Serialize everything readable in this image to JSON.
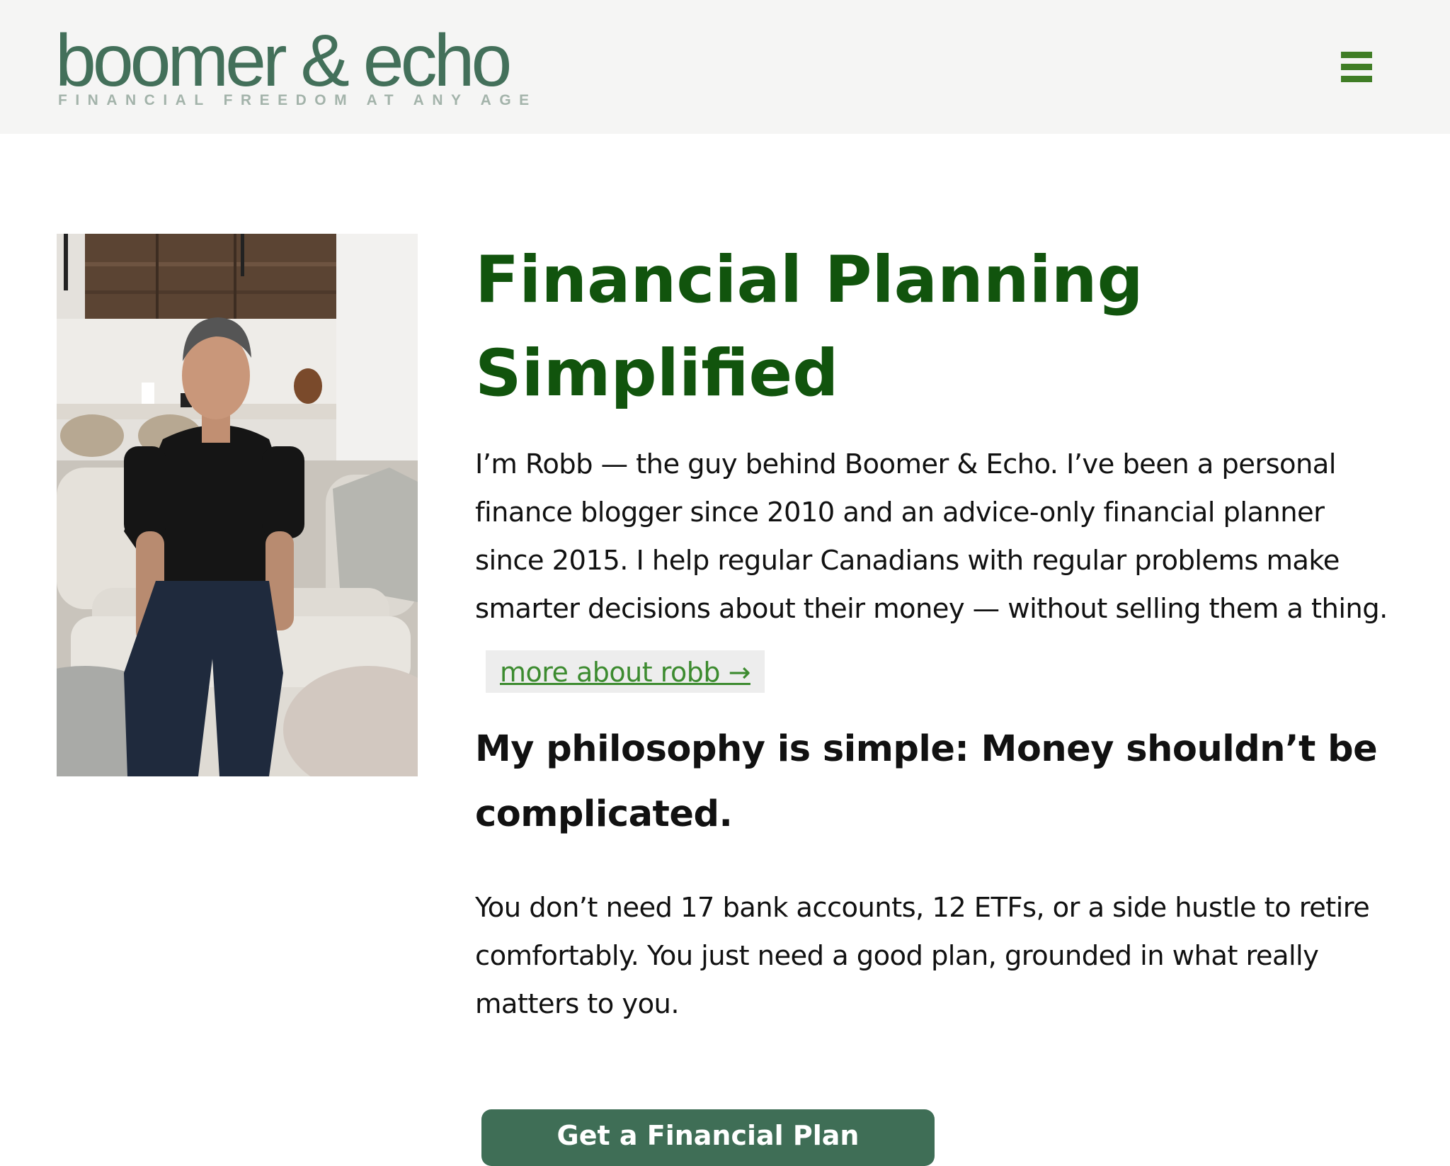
{
  "header": {
    "logo_name": "boomer & echo",
    "logo_tagline": "FINANCIAL FREEDOM AT ANY AGE",
    "menu_icon": "hamburger-menu-icon"
  },
  "hero": {
    "photo_icon": "portrait-photo",
    "title": "Financial Planning Simplified",
    "intro": "I’m Robb — the guy behind Boomer & Echo. I’ve been a personal finance blogger since 2010 and an advice-only financial planner since 2015. I help regular Canadians with regular problems make smarter decisions about their money — without selling them a thing.",
    "more_link": "more about robb →",
    "philosophy_heading": "My philosophy is simple: Money shouldn’t be complicated.",
    "body": "You don’t need 17 bank accounts, 12 ETFs, or a side hustle to retire comfortably. You just need a good plan, grounded in what really matters to you.",
    "cta_label": "Get a Financial Plan"
  },
  "colors": {
    "accent_green": "#11540d",
    "logo_green": "#43705a",
    "link_green": "#3c8b2f",
    "button_green": "#3f6e56",
    "header_bg": "#f5f5f4"
  }
}
